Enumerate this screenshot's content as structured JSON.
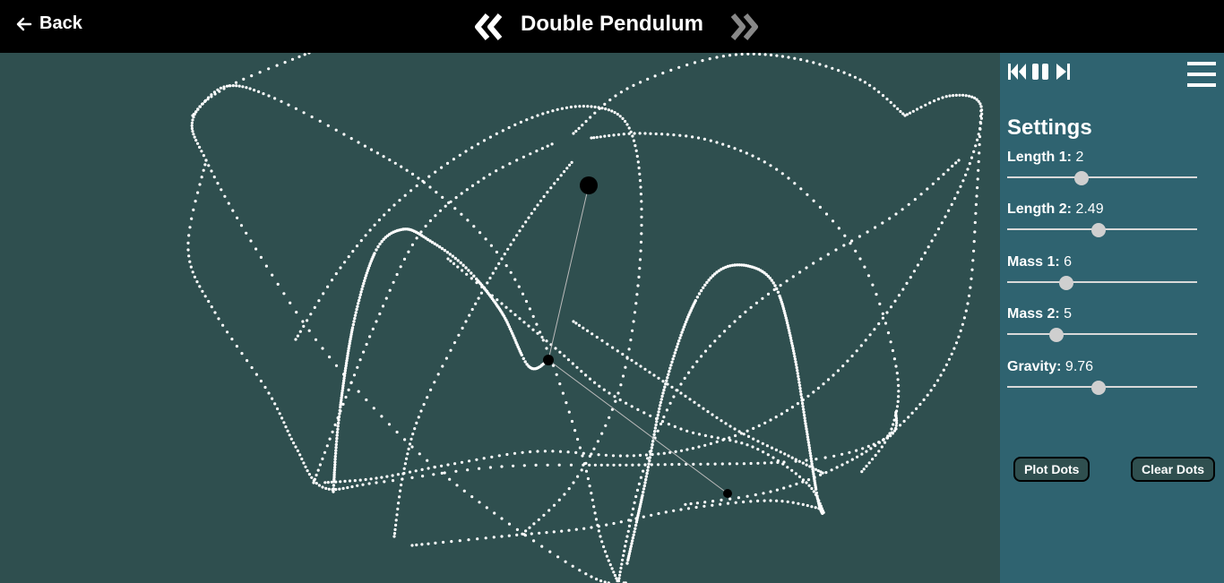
{
  "header": {
    "back_label": "Back",
    "title": "Double Pendulum",
    "prev_icon": "double-chevron-left-icon",
    "next_icon": "double-chevron-right-icon"
  },
  "controls": {
    "media_icons": [
      "skip-back-icon",
      "pause-icon",
      "skip-forward-icon"
    ],
    "menu_icon": "hamburger-menu-icon"
  },
  "settings": {
    "title": "Settings",
    "items": [
      {
        "label": "Length 1:",
        "value": "2",
        "fraction": 0.39
      },
      {
        "label": "Length 2:",
        "value": "2.49",
        "fraction": 0.48
      },
      {
        "label": "Mass 1:",
        "value": "6",
        "fraction": 0.31
      },
      {
        "label": "Mass 2:",
        "value": "5",
        "fraction": 0.26
      },
      {
        "label": "Gravity:",
        "value": "9.76",
        "fraction": 0.48
      }
    ],
    "plot_dots_label": "Plot Dots",
    "clear_dots_label": "Clear Dots"
  },
  "colors": {
    "background": "#2f4f4f",
    "panel": "#2f6370",
    "header": "#000000",
    "trail": "#ffffff"
  }
}
